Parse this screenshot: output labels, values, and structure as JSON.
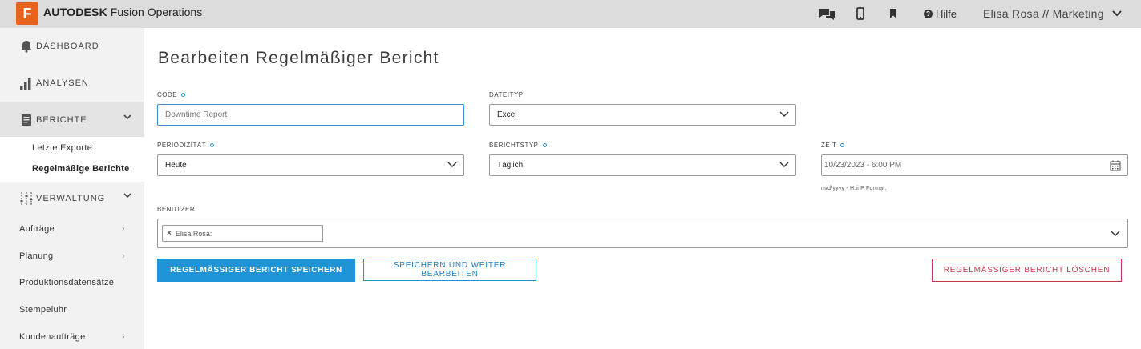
{
  "app": {
    "logo_letter": "F",
    "brand_bold": "AUTODESK",
    "brand_rest": "Fusion Operations"
  },
  "topbar": {
    "help_label": "Hilfe",
    "user_label": "Elisa Rosa // Marketing",
    "icons": [
      "chat-icon",
      "mobile-icon",
      "bookmark-icon",
      "help-icon",
      "chevron-down-icon"
    ]
  },
  "sidebar": {
    "dashboard": "DASHBOARD",
    "analysen": "ANALYSEN",
    "berichte": "BERICHTE",
    "berichte_sub": [
      "Letzte Exporte",
      "Regelmäßige Berichte"
    ],
    "verwaltung": "VERWALTUNG",
    "nav": [
      "Aufträge",
      "Planung",
      "Produktionsdatensätze",
      "Stempeluhr",
      "Kundenaufträge"
    ]
  },
  "page": {
    "title": "Bearbeiten Regelmäßiger Bericht"
  },
  "form": {
    "code_label": "CODE",
    "code_value": "Downtime Report",
    "dateityp_label": "DATEITYP",
    "dateityp_value": "Excel",
    "periodizitaet_label": "PERIODIZITÄT",
    "periodizitaet_value": "Heute",
    "berichtstyp_label": "BERICHTSTYP",
    "berichtstyp_value": "Täglich",
    "zeit_label": "ZEIT",
    "zeit_value": "10/23/2023 - 6:00 PM",
    "zeit_hint": "m/d/yyyy - H:ii P Format.",
    "benutzer_label": "BENUTZER",
    "benutzer_tag": "Elisa Rosa:"
  },
  "buttons": {
    "save": "REGELMÄSSIGER BERICHT SPEICHERN",
    "save_continue": "SPEICHERN UND WEITER BEARBEITEN",
    "delete": "REGELMÄSSIGER BERICHT LÖSCHEN"
  },
  "colors": {
    "primary": "#1e94d6",
    "danger": "#c8364a",
    "brand_orange": "#e8621b"
  }
}
